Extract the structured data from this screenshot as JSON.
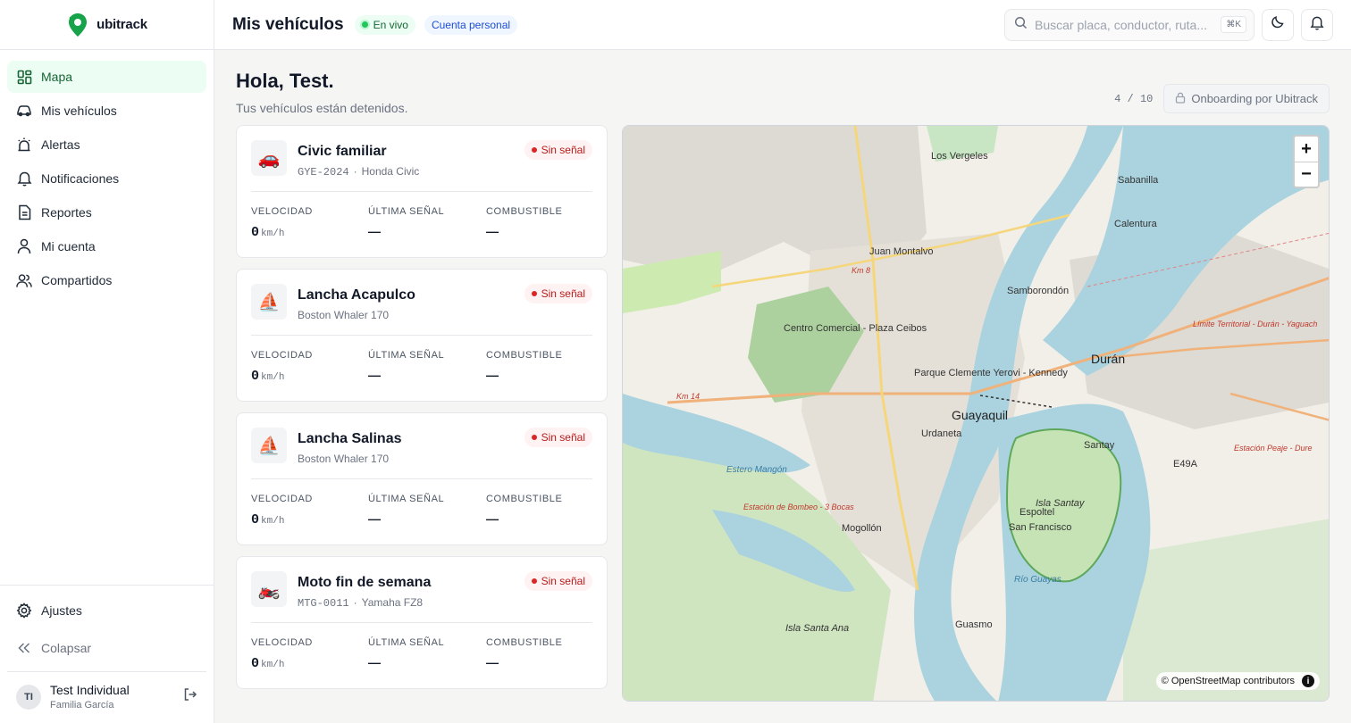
{
  "brand": {
    "name": "ubitrack",
    "accent": "#16a34a"
  },
  "sidebar": {
    "items": [
      {
        "label": "Mapa",
        "icon": "map-grid-icon",
        "active": true
      },
      {
        "label": "Mis vehículos",
        "icon": "car-icon"
      },
      {
        "label": "Alertas",
        "icon": "siren-icon"
      },
      {
        "label": "Notificaciones",
        "icon": "bell-icon"
      },
      {
        "label": "Reportes",
        "icon": "report-icon"
      },
      {
        "label": "Mi cuenta",
        "icon": "user-icon"
      },
      {
        "label": "Compartidos",
        "icon": "users-icon"
      }
    ],
    "settings": "Ajustes",
    "collapse": "Colapsar",
    "user": {
      "initials": "TI",
      "name": "Test Individual",
      "group": "Familia García"
    }
  },
  "header": {
    "title": "Mis vehículos",
    "live_badge": "En vivo",
    "account_badge": "Cuenta personal",
    "search_placeholder": "Buscar placa, conductor, ruta...",
    "shortcut": "⌘K"
  },
  "greeting": {
    "title": "Hola, Test.",
    "subtitle": "Tus vehículos están detenidos."
  },
  "onboarding": {
    "progress": "4 / 10",
    "label": "Onboarding por Ubitrack"
  },
  "metric_labels": {
    "speed": "VELOCIDAD",
    "last_signal": "ÚLTIMA SEÑAL",
    "fuel": "COMBUSTIBLE",
    "unit": "km/h"
  },
  "vehicles": [
    {
      "name": "Civic familiar",
      "plate": "GYE-2024",
      "model": "Honda Civic",
      "icon": "🚗",
      "status": "Sin señal",
      "speed": "0",
      "last_signal": "—",
      "fuel": "—"
    },
    {
      "name": "Lancha Acapulco",
      "plate": "",
      "model": "Boston Whaler 170",
      "icon": "⛵",
      "status": "Sin señal",
      "speed": "0",
      "last_signal": "—",
      "fuel": "—"
    },
    {
      "name": "Lancha Salinas",
      "plate": "",
      "model": "Boston Whaler 170",
      "icon": "⛵",
      "status": "Sin señal",
      "speed": "0",
      "last_signal": "—",
      "fuel": "—"
    },
    {
      "name": "Moto fin de semana",
      "plate": "MTG-0011",
      "model": "Yamaha FZ8",
      "icon": "🏍️",
      "status": "Sin señal",
      "speed": "0",
      "last_signal": "—",
      "fuel": "—"
    }
  ],
  "map": {
    "zoom_in": "+",
    "zoom_out": "−",
    "attribution": "© OpenStreetMap contributors",
    "labels": {
      "guayaquil": "Guayaquil",
      "duran": "Durán",
      "isla_santay": "Isla Santay",
      "urdaneta": "Urdaneta",
      "santay": "Santay",
      "rio_guayas": "Río Guayas",
      "guasmo": "Guasmo",
      "mogollon": "Mogollón",
      "sabanilla": "Sabanilla",
      "calentura": "Calentura",
      "los_vergeles": "Los Vergeles",
      "juan_montalvo": "Juan Montalvo",
      "samborondon": "Samborondón",
      "espoltel": "Espoltel",
      "san_francisco": "San Francisco",
      "e49a": "E49A",
      "km8": "Km 8",
      "km14": "Km 14",
      "estero": "Estero Mangón",
      "bombeo": "Estación de Bombeo - 3 Bocas",
      "peaje": "Estación Peaje - Dure",
      "limite": "Límite Territorial - Durán - Yaguach",
      "isla_santa_ana": "Isla Santa Ana",
      "parque_clemente": "Parque Clemente Yerovi - Kennedy",
      "centro_comercial": "Centro Comercial - Plaza Ceibos"
    }
  }
}
